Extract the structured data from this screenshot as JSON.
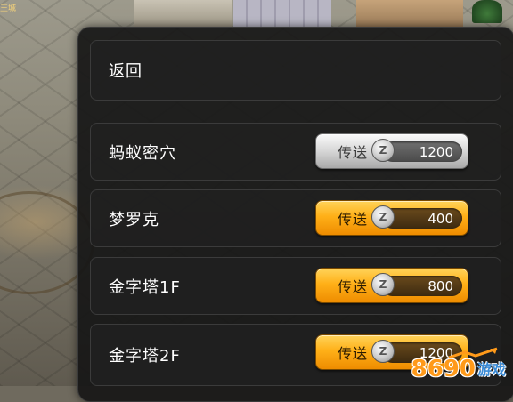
{
  "scene": {
    "corner_tag": "王城"
  },
  "panel": {
    "back_label": "返回",
    "destinations": [
      {
        "name": "蚂蚁密穴",
        "button_label": "传送",
        "cost": "1200",
        "style": "silver"
      },
      {
        "name": "梦罗克",
        "button_label": "传送",
        "cost": "400",
        "style": "gold"
      },
      {
        "name": "金字塔1F",
        "button_label": "传送",
        "cost": "800",
        "style": "gold"
      },
      {
        "name": "金字塔2F",
        "button_label": "传送",
        "cost": "1200",
        "style": "gold"
      }
    ],
    "coin_symbol": "Z"
  },
  "watermark": {
    "number": "8690",
    "text": "游戏"
  },
  "colors": {
    "panel_bg": "#161616",
    "gold_button": "#ffb018",
    "silver_button": "#d6d6d6",
    "watermark_orange": "#ff9a1a",
    "watermark_blue": "#3b8bd6"
  }
}
